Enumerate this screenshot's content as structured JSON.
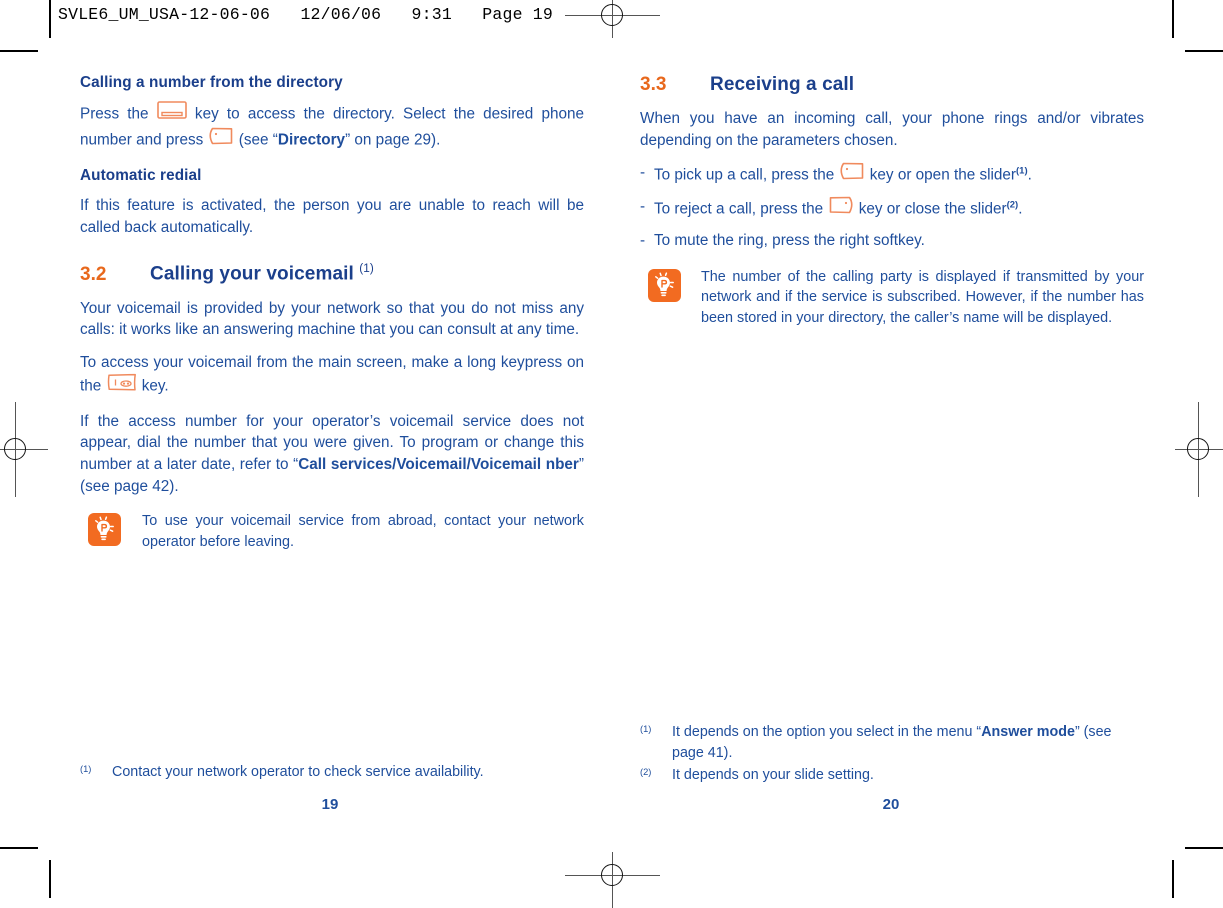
{
  "page_header": "SVLE6_UM_USA-12-06-06   12/06/06   9:31   Page 19",
  "colors": {
    "text_blue": "#1F4E9C",
    "heading_blue": "#1B3F8B",
    "accent_orange": "#E8681C",
    "icon_outline": "#F08A5D"
  },
  "left_column": {
    "sub_heading_1": "Calling a number from the directory",
    "para_1_a": "Press the",
    "para_1_icon": "directory-key-icon",
    "para_1_b": "key to access the directory. Select the desired phone number and press",
    "para_1_icon2": "call-key-icon",
    "para_1_c": "(see “",
    "para_1_bold": "Directory",
    "para_1_d": "” on page 29).",
    "sub_heading_2": "Automatic redial",
    "para_2": "If this feature is activated, the person you are unable to reach will be called back automatically.",
    "section": {
      "number": "3.2",
      "title": "Calling your voicemail",
      "footnote_mark": "(1)"
    },
    "para_3": "Your voicemail is provided by your network so that you do not miss any calls: it works like an answering machine that you can consult at any time.",
    "para_4_a": "To access your voicemail from the main screen, make a long keypress on the",
    "para_4_icon": "voicemail-one-key-icon",
    "para_4_b": "key.",
    "para_5_a": "If the access number for your operator’s voicemail service does not appear, dial the number that you were given. To program or change this number at a later date, refer to “",
    "para_5_bold": "Call services/Voicemail/Voicemail nber",
    "para_5_b": "” (see page 42).",
    "note": {
      "icon": "lightbulb-tip-icon",
      "text": "To use your voicemail service from abroad, contact your network operator before leaving."
    },
    "footnotes": [
      {
        "mark": "(1)",
        "text": "Contact your network operator to check service availability."
      }
    ],
    "page_number": "19"
  },
  "right_column": {
    "section": {
      "number": "3.3",
      "title": "Receiving a call"
    },
    "para_1": "When you have an incoming call, your phone rings and/or vibrates depending on the parameters chosen.",
    "bullets": [
      {
        "dash": "-",
        "text_a": "To pick up a call, press the",
        "icon": "call-key-icon",
        "text_b": "key or open the slider",
        "sup": "(1)",
        "text_c": "."
      },
      {
        "dash": "-",
        "text_a": "To reject a call, press the",
        "icon": "hangup-key-icon",
        "text_b": "key or close the slider",
        "sup": "(2)",
        "text_c": "."
      },
      {
        "dash": "-",
        "text_a": "To mute the ring, press the right softkey.",
        "icon": "",
        "text_b": "",
        "sup": "",
        "text_c": ""
      }
    ],
    "note": {
      "icon": "lightbulb-tip-icon",
      "text": "The number of the calling party is displayed if transmitted by your network and if the service is subscribed. However, if the number has been stored in your directory, the caller’s name will be displayed."
    },
    "footnotes": [
      {
        "mark": "(1)",
        "text_a": "It depends on the option you select in the menu “",
        "bold": "Answer mode",
        "text_b": "” (see page 41)."
      },
      {
        "mark": "(2)",
        "text_a": "It depends on your slide setting.",
        "bold": "",
        "text_b": ""
      }
    ],
    "page_number": "20"
  }
}
